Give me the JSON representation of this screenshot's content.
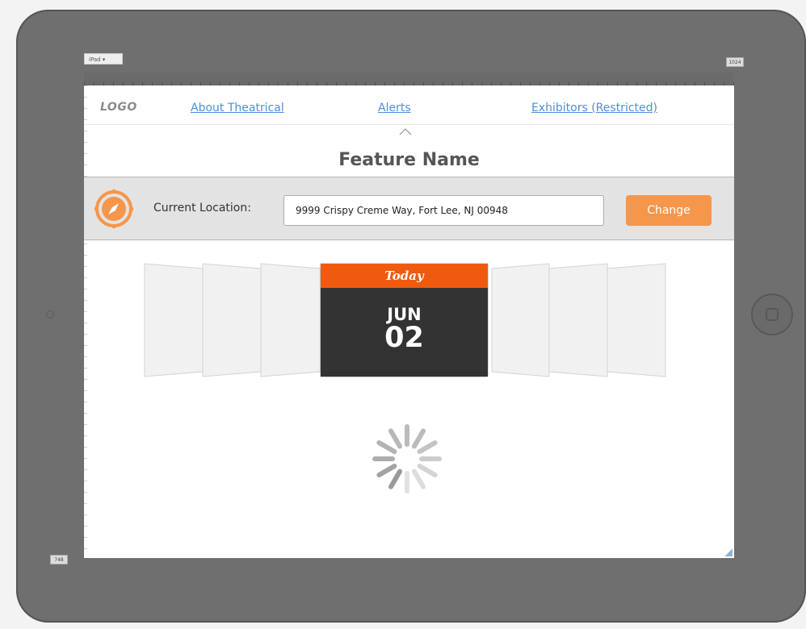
{
  "frame": {
    "device_label": "iPad ▾",
    "width_label": "1024",
    "height_label": "748"
  },
  "nav": {
    "logo": "LOGO",
    "links": [
      "About Theatrical",
      "Alerts",
      "Exhibitors (Restricted)"
    ]
  },
  "feature_title": "Feature Name",
  "location": {
    "label": "Current Location:",
    "value": "9999 Crispy Creme Way, Fort Lee, NJ 00948",
    "button": "Change",
    "icon": "compass-icon"
  },
  "date_card": {
    "header": "Today",
    "month": "JUN",
    "day": "02"
  },
  "colors": {
    "accent_orange": "#f5964b",
    "today_orange": "#f05a0f",
    "card_dark": "#333333",
    "link_blue": "#4a90d9"
  }
}
